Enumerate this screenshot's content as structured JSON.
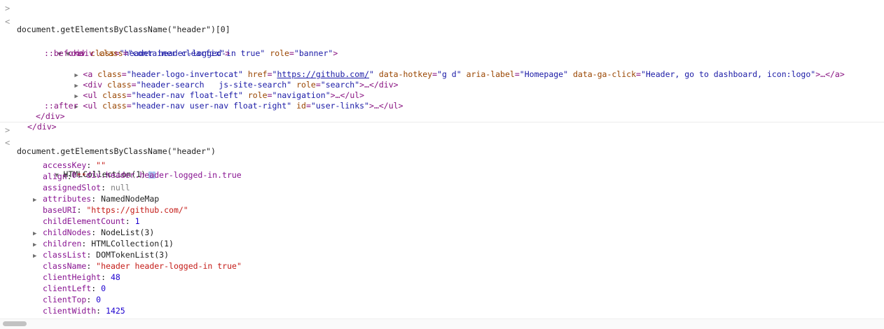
{
  "console": {
    "entries": [
      {
        "input": "document.getElementsByClassName(\"header\")[0]",
        "output_lines": [
          {
            "tag": "div",
            "class": "header header-logged-in true",
            "role": "banner"
          },
          {
            "tag": "div",
            "class": "container clearfix"
          },
          {
            "pseudo_before": "::before"
          },
          {
            "a_class": "header-logo-invertocat",
            "a_href": "https://github.com/",
            "a_hotkey": "g d",
            "a_label": "Homepage",
            "a_gaclick": "Header, go to dashboard, icon:logo",
            "a_close": ">…</a>"
          },
          {
            "div2_class": "header-search   js-site-search",
            "div2_role": "search",
            "div2_close": ">…</div>"
          },
          {
            "ul1_class": "header-nav float-left",
            "ul1_role": "navigation",
            "ul1_close": ">…</ul>"
          },
          {
            "ul2_class": "header-nav user-nav float-right",
            "ul2_id": "user-links",
            "ul2_close": ">…</ul>"
          },
          {
            "pseudo_after": "::after"
          },
          {
            "close_inner": "</div>"
          },
          {
            "close_outer": "</div>"
          }
        ]
      },
      {
        "input": "document.getElementsByClassName(\"header\")",
        "collection": "HTMLCollection(1)",
        "item_label": "0: div.header.header-logged-in.true",
        "props": [
          {
            "key": "accessKey",
            "value": "\"\"",
            "kind": "str",
            "expandable": false
          },
          {
            "key": "align",
            "value": "\"\"",
            "kind": "str",
            "expandable": false
          },
          {
            "key": "assignedSlot",
            "value": "null",
            "kind": "nul",
            "expandable": false
          },
          {
            "key": "attributes",
            "value": "NamedNodeMap",
            "kind": "obj",
            "expandable": true
          },
          {
            "key": "baseURI",
            "value": "\"https://github.com/\"",
            "kind": "str",
            "expandable": false
          },
          {
            "key": "childElementCount",
            "value": "1",
            "kind": "num",
            "expandable": false
          },
          {
            "key": "childNodes",
            "value": "NodeList(3)",
            "kind": "obj",
            "expandable": true
          },
          {
            "key": "children",
            "value": "HTMLCollection(1)",
            "kind": "obj",
            "expandable": true
          },
          {
            "key": "classList",
            "value": "DOMTokenList(3)",
            "kind": "obj",
            "expandable": true
          },
          {
            "key": "className",
            "value": "\"header header-logged-in true\"",
            "kind": "str",
            "expandable": false
          },
          {
            "key": "clientHeight",
            "value": "48",
            "kind": "num",
            "expandable": false
          },
          {
            "key": "clientLeft",
            "value": "0",
            "kind": "num",
            "expandable": false
          },
          {
            "key": "clientTop",
            "value": "0",
            "kind": "num",
            "expandable": false
          },
          {
            "key": "clientWidth",
            "value": "1425",
            "kind": "num",
            "expandable": false
          }
        ]
      }
    ],
    "prompt_glyph": ">",
    "result_glyph": "<",
    "info_badge": "i"
  },
  "colors": {
    "tag": "#881280",
    "attr": "#994500",
    "value": "#1a1aa6",
    "string": "#c41a16",
    "number": "#1c00cf",
    "key": "#881391"
  }
}
